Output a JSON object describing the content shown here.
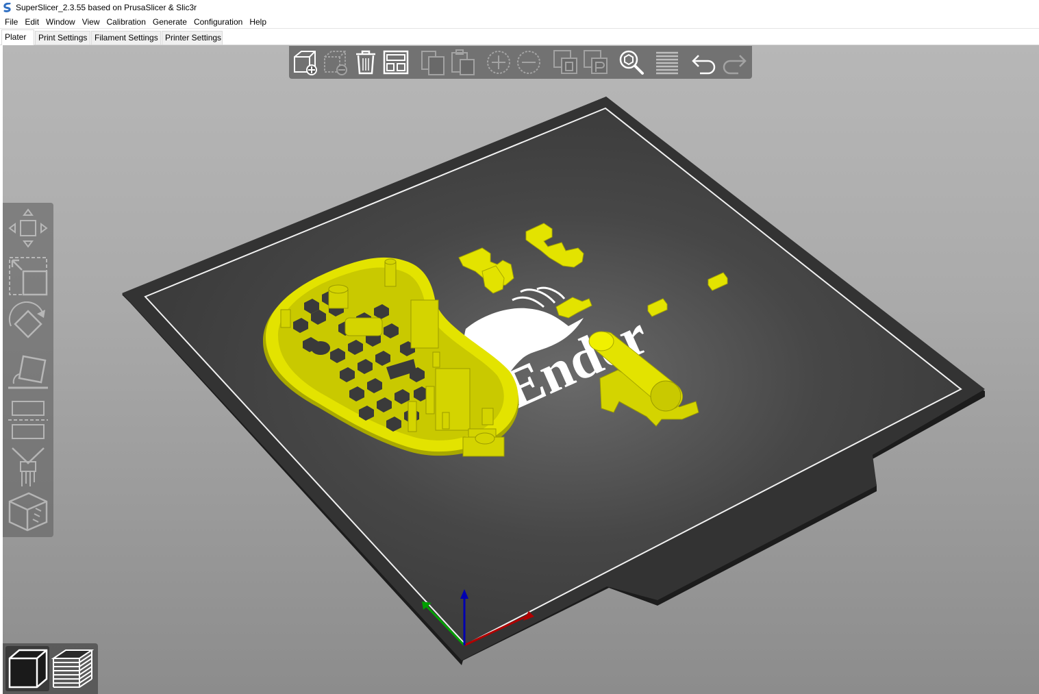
{
  "window": {
    "title": "SuperSlicer_2.3.55 based on PrusaSlicer & Slic3r",
    "logo_icon": "superslicer-logo-icon"
  },
  "menu": [
    "File",
    "Edit",
    "Window",
    "View",
    "Calibration",
    "Generate",
    "Configuration",
    "Help"
  ],
  "tabs": [
    {
      "label": "Plater",
      "active": true
    },
    {
      "label": "Print Settings",
      "active": false
    },
    {
      "label": "Filament Settings",
      "active": false
    },
    {
      "label": "Printer Settings",
      "active": false
    }
  ],
  "bed": {
    "logo_text": "Ender",
    "colors": {
      "plate": "#464646",
      "frame": "#2a2a2a",
      "outline": "#ffffff",
      "model": "#e3e300",
      "model_shadow": "#a8a800"
    }
  },
  "toolbar_icons": [
    "add-object-icon",
    "delete-object-icon",
    "delete-all-icon",
    "arrange-icon",
    "copy-icon",
    "paste-icon",
    "add-instance-icon",
    "remove-instance-icon",
    "split-objects-icon",
    "split-parts-icon",
    "search-icon",
    "layers-editing-icon",
    "undo-icon",
    "redo-icon"
  ],
  "left_tool_icons": [
    "move-icon",
    "scale-icon",
    "rotate-icon",
    "place-on-face-icon",
    "cut-icon",
    "paint-supports-icon",
    "seam-painting-icon"
  ],
  "view_icons": [
    "3d-view-icon",
    "preview-layers-icon"
  ],
  "axes_colors": {
    "x": "#b00000",
    "y": "#00a000",
    "z": "#0000b0"
  }
}
